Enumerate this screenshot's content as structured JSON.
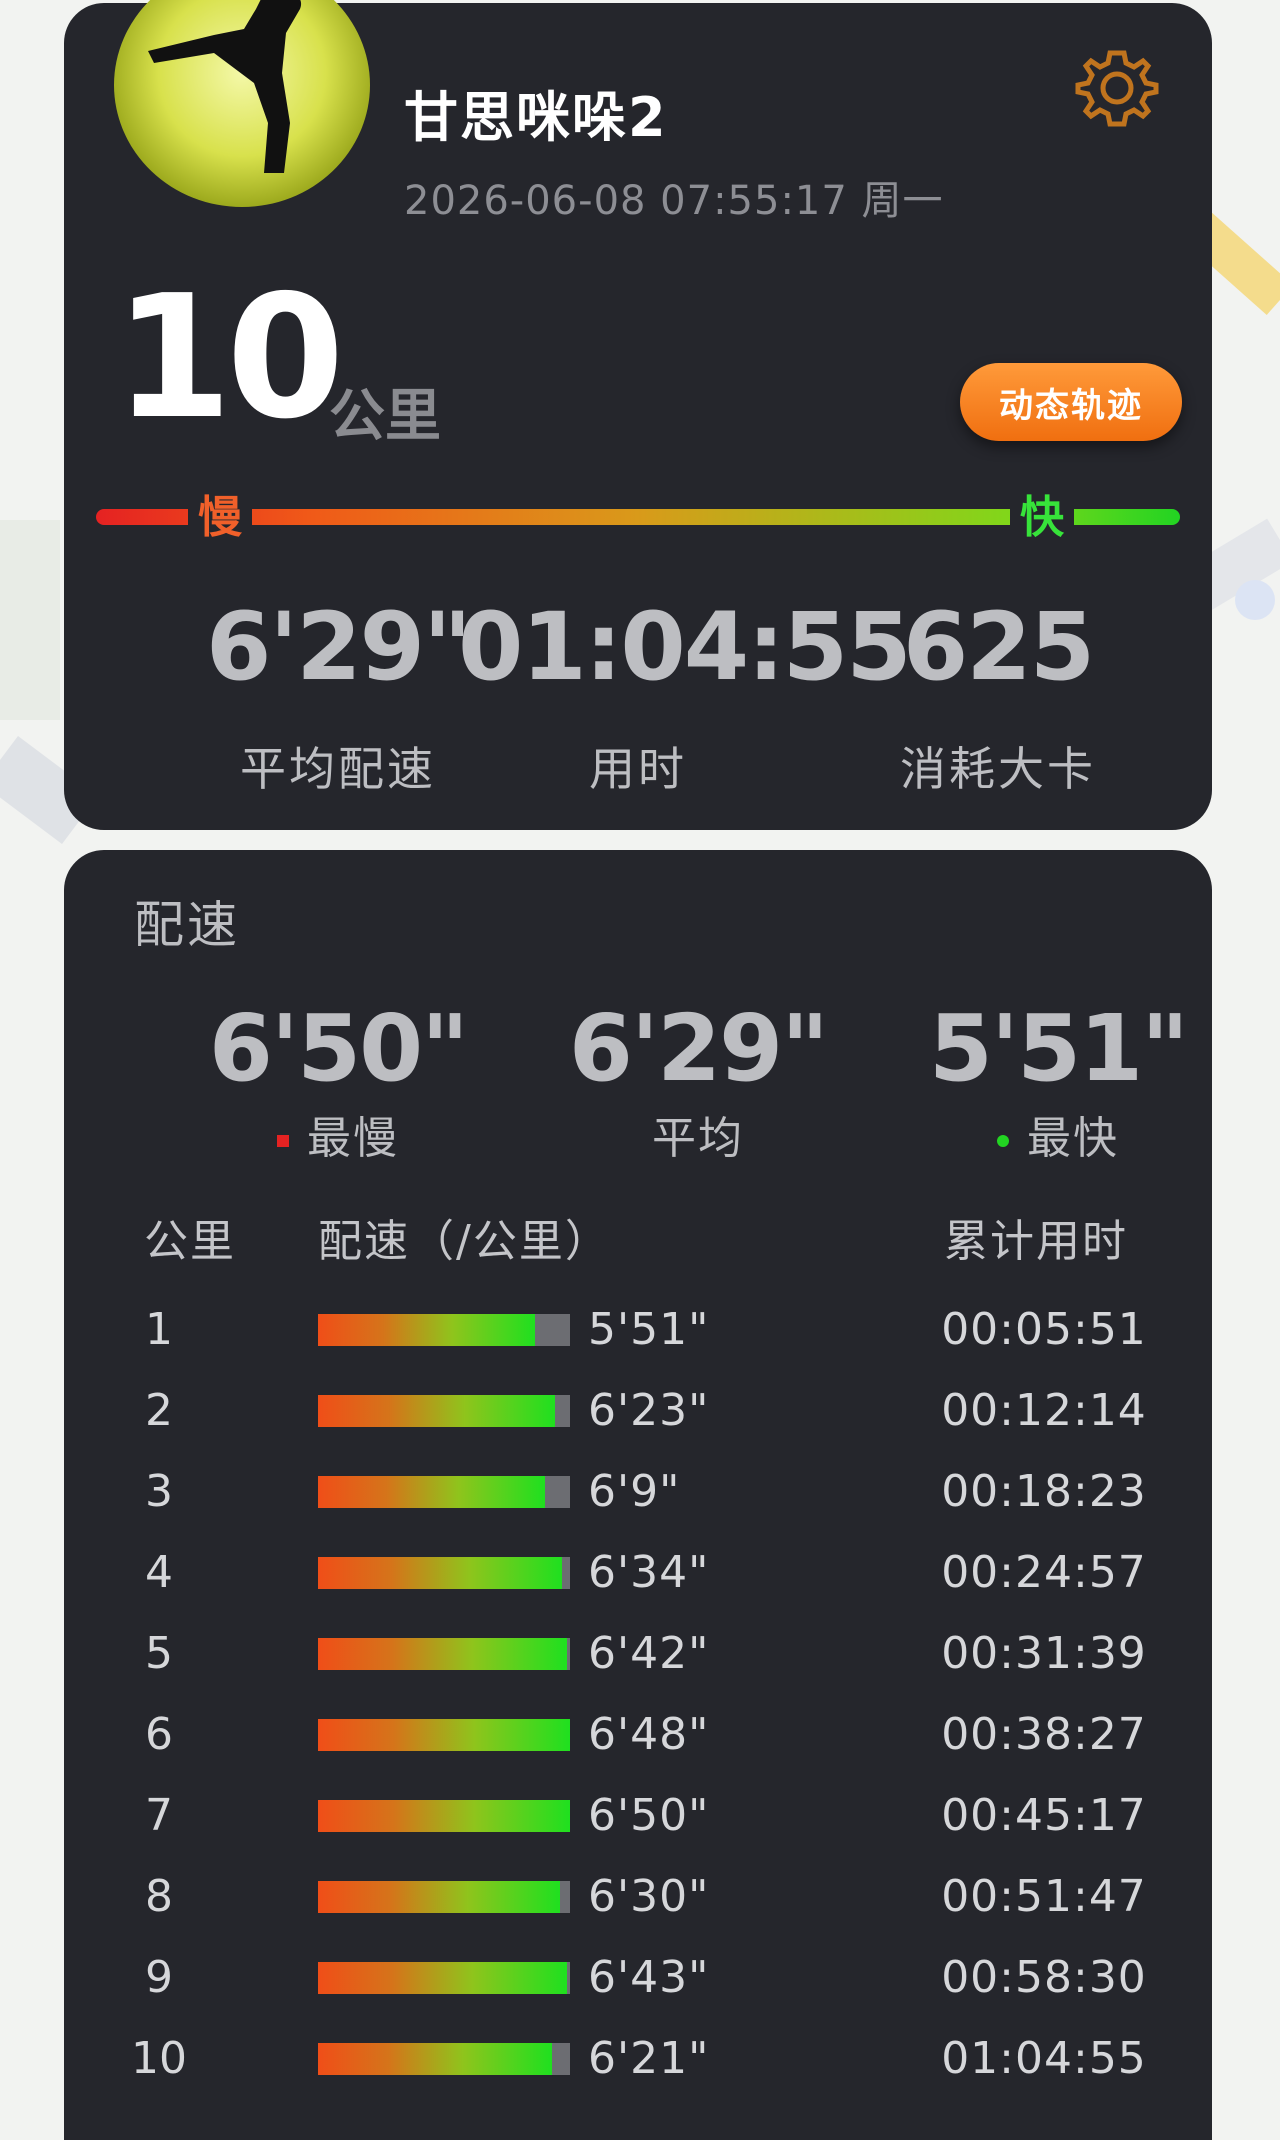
{
  "header": {
    "user_name": "甘思咪哚2",
    "datetime": "2026-06-08 07:55:17 周一",
    "avatar": "kung-fu-kick-silhouette",
    "settings_icon": "gear-icon"
  },
  "summary": {
    "distance": "10",
    "distance_unit": "公里",
    "track_button": "动态轨迹",
    "speed_slow_label": "慢",
    "speed_fast_label": "快",
    "stats": [
      {
        "value": "6'29\"",
        "label": "平均配速"
      },
      {
        "value": "01:04:55",
        "label": "用时"
      },
      {
        "value": "625",
        "label": "消耗大卡"
      }
    ]
  },
  "pace": {
    "title": "配速",
    "slowest": {
      "value": "6'50\"",
      "label": "最慢"
    },
    "average": {
      "value": "6'29\"",
      "label": "平均"
    },
    "fastest": {
      "value": "5'51\"",
      "label": "最快"
    },
    "columns": {
      "km": "公里",
      "pace": "配速（/公里）",
      "cumulative": "累计用时"
    },
    "splits": [
      {
        "km": "1",
        "pace": "5'51\"",
        "cumulative": "00:05:51",
        "fill": 0.86
      },
      {
        "km": "2",
        "pace": "6'23\"",
        "cumulative": "00:12:14",
        "fill": 0.94
      },
      {
        "km": "3",
        "pace": "6'9\"",
        "cumulative": "00:18:23",
        "fill": 0.9
      },
      {
        "km": "4",
        "pace": "6'34\"",
        "cumulative": "00:24:57",
        "fill": 0.97
      },
      {
        "km": "5",
        "pace": "6'42\"",
        "cumulative": "00:31:39",
        "fill": 0.99
      },
      {
        "km": "6",
        "pace": "6'48\"",
        "cumulative": "00:38:27",
        "fill": 1.0
      },
      {
        "km": "7",
        "pace": "6'50\"",
        "cumulative": "00:45:17",
        "fill": 1.0
      },
      {
        "km": "8",
        "pace": "6'30\"",
        "cumulative": "00:51:47",
        "fill": 0.96
      },
      {
        "km": "9",
        "pace": "6'43\"",
        "cumulative": "00:58:30",
        "fill": 0.99
      },
      {
        "km": "10",
        "pace": "6'21\"",
        "cumulative": "01:04:55",
        "fill": 0.93
      }
    ]
  },
  "colors": {
    "card_bg": "#25262c",
    "accent_orange": "#f06f10",
    "slow_red": "#e52222",
    "fast_green": "#22d422"
  }
}
